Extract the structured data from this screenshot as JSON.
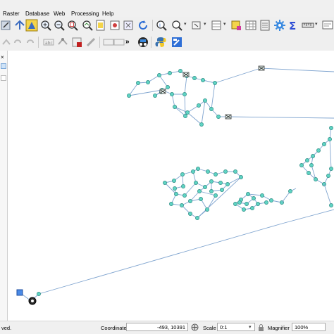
{
  "menubar": {
    "items": [
      "Raster",
      "Database",
      "Web",
      "Processing",
      "Help"
    ]
  },
  "toolbar": {
    "icons": [
      "edit-icon",
      "save-icon",
      "pan-icon",
      "zoom-in-icon",
      "zoom-out-icon",
      "zoom-full-icon",
      "zoom-layer-icon",
      "zoom-selection-icon",
      "zoom-native-icon",
      "refresh-icon",
      "identify-icon",
      "select-icon",
      "deselect-icon",
      "table-icon",
      "field-calculator-icon",
      "statistics-icon",
      "measure-icon",
      "annotation-icon",
      "digitize-icon",
      "node-tool-icon",
      "python-icon",
      "plugin-icon"
    ],
    "overflow": "»"
  },
  "status": {
    "left_text": "ved.",
    "coordinate_label": "Coordinate",
    "coordinate_value": "-493, 10391",
    "scale_label": "Scale",
    "scale_value": "0:1",
    "magnifier_label": "Magnifier",
    "magnifier_value": "100%"
  },
  "colors": {
    "node_fill": "#5fd3c3",
    "node_stroke": "#2c8a82",
    "edge": "#7fa4cf",
    "accent_blue": "#2f6fd6",
    "canvas_bg": "#ffffff"
  }
}
